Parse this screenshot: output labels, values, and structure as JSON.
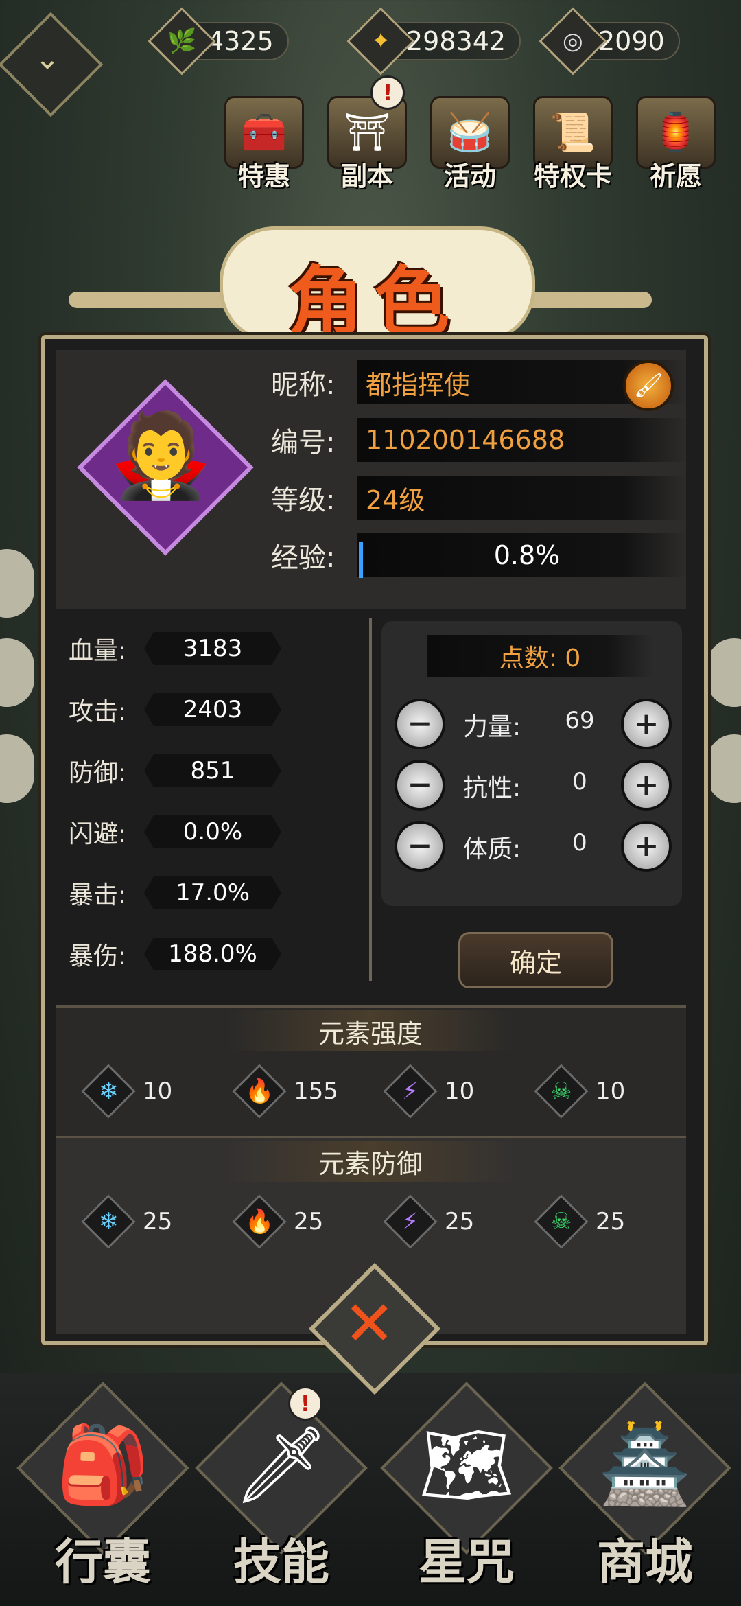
{
  "currencies": [
    {
      "icon": "green-leaf-icon",
      "glyph": "🌿",
      "value": "4325"
    },
    {
      "icon": "gold-coin-icon",
      "glyph": "✦",
      "value": "298342"
    },
    {
      "icon": "silver-coin-icon",
      "glyph": "◎",
      "value": "2090"
    }
  ],
  "features": [
    {
      "label": "特惠",
      "glyph": "🧰"
    },
    {
      "label": "副本",
      "glyph": "⛩"
    },
    {
      "label": "活动",
      "glyph": "🥁"
    },
    {
      "label": "特权卡",
      "glyph": "📜"
    },
    {
      "label": "祈愿",
      "glyph": "🏮"
    }
  ],
  "title": "角色",
  "profile": {
    "nickname_label": "昵称:",
    "nickname": "都指挥使",
    "id_label": "编号:",
    "id": "110200146688",
    "level_label": "等级:",
    "level": "24级",
    "exp_label": "经验:",
    "exp": "0.8%",
    "exp_fraction": 0.008
  },
  "stats": [
    {
      "label": "血量:",
      "value": "3183"
    },
    {
      "label": "攻击:",
      "value": "2403"
    },
    {
      "label": "防御:",
      "value": "851"
    },
    {
      "label": "闪避:",
      "value": "0.0%"
    },
    {
      "label": "暴击:",
      "value": "17.0%"
    },
    {
      "label": "暴伤:",
      "value": "188.0%"
    }
  ],
  "points": {
    "label": "点数: 0"
  },
  "attributes": [
    {
      "label": "力量:",
      "value": "69"
    },
    {
      "label": "抗性:",
      "value": "0"
    },
    {
      "label": "体质:",
      "value": "0"
    }
  ],
  "confirm_label": "确定",
  "element_strength": {
    "title": "元素强度",
    "items": [
      {
        "icon": "ice-icon",
        "glyph": "❄",
        "color": "#6ad0ff",
        "value": "10"
      },
      {
        "icon": "fire-icon",
        "glyph": "🔥",
        "color": "#ff8a2a",
        "value": "155"
      },
      {
        "icon": "lightning-icon",
        "glyph": "⚡",
        "color": "#b77cff",
        "value": "10"
      },
      {
        "icon": "poison-skull-icon",
        "glyph": "☠",
        "color": "#39d66a",
        "value": "10"
      }
    ]
  },
  "element_defense": {
    "title": "元素防御",
    "items": [
      {
        "icon": "ice-icon",
        "glyph": "❄",
        "color": "#6ad0ff",
        "value": "25"
      },
      {
        "icon": "fire-icon",
        "glyph": "🔥",
        "color": "#ff8a2a",
        "value": "25"
      },
      {
        "icon": "lightning-icon",
        "glyph": "⚡",
        "color": "#b77cff",
        "value": "25"
      },
      {
        "icon": "poison-skull-icon",
        "glyph": "☠",
        "color": "#39d66a",
        "value": "25"
      }
    ]
  },
  "bottom_nav": [
    {
      "label": "行囊",
      "glyph": "🎒"
    },
    {
      "label": "技能",
      "glyph": "🗡"
    },
    {
      "label": "星咒",
      "glyph": "🗺"
    },
    {
      "label": "商城",
      "glyph": "🏯"
    }
  ],
  "badge_glyph": "!"
}
